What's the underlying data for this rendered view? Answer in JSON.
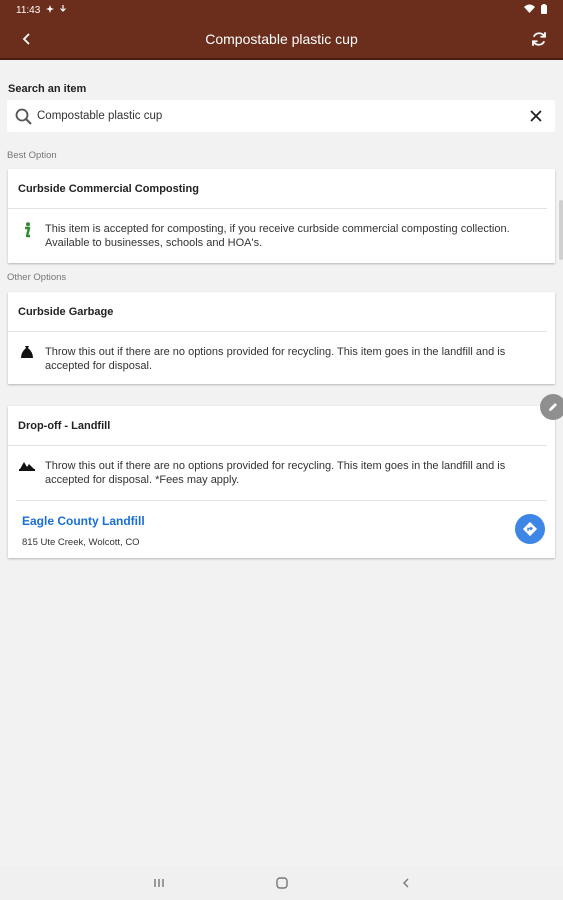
{
  "status_bar": {
    "time": "11:43"
  },
  "app_bar": {
    "title": "Compostable plastic cup",
    "back_icon": "back-icon",
    "refresh_icon": "refresh-icon"
  },
  "search": {
    "label": "Search an item",
    "value": "Compostable plastic cup",
    "placeholder": "Search an item"
  },
  "best_option": {
    "section_label": "Best Option",
    "title": "Curbside Commercial Composting",
    "icon": "info-icon",
    "text": "This item is accepted for composting, if you receive curbside commercial composting collection. Available to businesses, schools and HOA's."
  },
  "other_options": {
    "section_label": "Other Options",
    "items": [
      {
        "title": "Curbside Garbage",
        "icon": "garbage-bag-icon",
        "text": "Throw this out if there are no options provided for recycling. This item goes in the landfill and is accepted for disposal."
      },
      {
        "title": "Drop-off - Landfill",
        "icon": "landfill-icon",
        "text": "Throw this out if there are no options provided for recycling. This item goes in the landfill and is accepted for disposal. *Fees may apply.",
        "location": {
          "name": "Eagle County Landfill",
          "address": "815 Ute Creek, Wolcott, CO",
          "icon": "directions-icon"
        }
      }
    ]
  },
  "colors": {
    "header": "#6b2e1c",
    "link": "#1a6ed8",
    "directions": "#3d86e6",
    "info_icon": "#2e8b2e"
  }
}
